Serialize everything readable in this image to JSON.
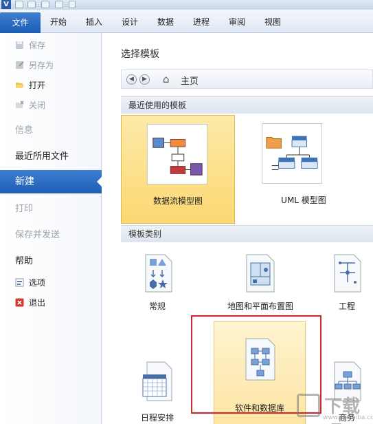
{
  "app": {
    "logo_letter": "V"
  },
  "tabs": {
    "file": "文件",
    "items": [
      "开始",
      "插入",
      "设计",
      "数据",
      "进程",
      "审阅",
      "视图"
    ]
  },
  "nav": {
    "save": "保存",
    "save_as": "另存为",
    "open": "打开",
    "close": "关闭",
    "info": "信息",
    "recent": "最近所用文件",
    "new": "新建",
    "print": "打印",
    "save_send": "保存并发送",
    "help": "帮助",
    "options": "选项",
    "exit": "退出"
  },
  "main": {
    "title": "选择模板",
    "breadcrumb": "主页",
    "recent_section": "最近使用的模板",
    "category_section": "模板类别",
    "recent_templates": [
      "数据流模型图",
      "UML 模型图"
    ],
    "categories": [
      "常规",
      "地图和平面布置图",
      "工程",
      "日程安排",
      "软件和数据库",
      "商务"
    ]
  },
  "watermark": {
    "text": "下载吧",
    "url": "www.xiazaiba.com"
  },
  "colors": {
    "accent": "#1f5fb7",
    "selection": "#fbd873",
    "highlight_box": "#d4232a"
  }
}
